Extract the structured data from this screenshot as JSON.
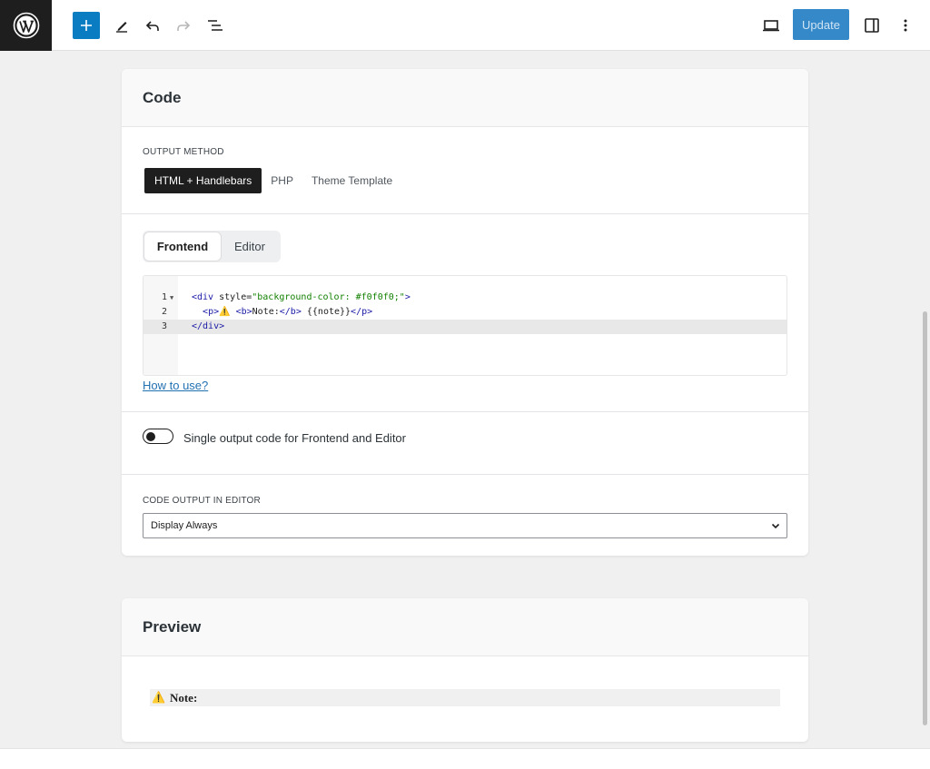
{
  "toolbar": {
    "logo_icon": "wordpress-logo",
    "add_icon": "plus-icon",
    "tools_icon": "pencil-icon",
    "undo_icon": "undo-icon",
    "redo_icon": "redo-icon",
    "list_view_icon": "list-view-icon",
    "preview_icon": "desktop-icon",
    "update_label": "Update",
    "settings_icon": "sidebar-panel-icon",
    "options_icon": "more-vertical-icon",
    "accent_color": "#0a7cc1"
  },
  "code_card": {
    "title": "Code",
    "output_method_label": "OUTPUT METHOD",
    "output_methods": [
      "HTML + Handlebars",
      "PHP",
      "Theme Template"
    ],
    "active_output_method": "HTML + Handlebars",
    "view_tabs": [
      "Frontend",
      "Editor"
    ],
    "active_view_tab": "Frontend",
    "code_lines": [
      {
        "num": "1",
        "foldable": true,
        "parts": [
          [
            "tag",
            "<div "
          ],
          [
            "plain",
            "style="
          ],
          [
            "str",
            "\"background-color: #f0f0f0;\""
          ],
          [
            "tag",
            ">"
          ]
        ]
      },
      {
        "num": "2",
        "foldable": false,
        "parts": [
          [
            "plain",
            "  "
          ],
          [
            "tag",
            "<p>"
          ],
          [
            "plain",
            "⚠️ "
          ],
          [
            "tag",
            "<b>"
          ],
          [
            "plain",
            "Note:"
          ],
          [
            "tag",
            "</b>"
          ],
          [
            "plain",
            " {{note}}"
          ],
          [
            "tag",
            "</p>"
          ]
        ]
      },
      {
        "num": "3",
        "foldable": false,
        "parts": [
          [
            "tag",
            "</div>"
          ]
        ]
      }
    ],
    "how_to_use": "How to use?",
    "single_output_label": "Single output code for Frontend and Editor",
    "single_output_enabled": false,
    "code_output_label": "CODE OUTPUT IN EDITOR",
    "code_output_value": "Display Always"
  },
  "preview_card": {
    "title": "Preview",
    "warning_icon": "⚠️",
    "note_label": "Note:"
  }
}
